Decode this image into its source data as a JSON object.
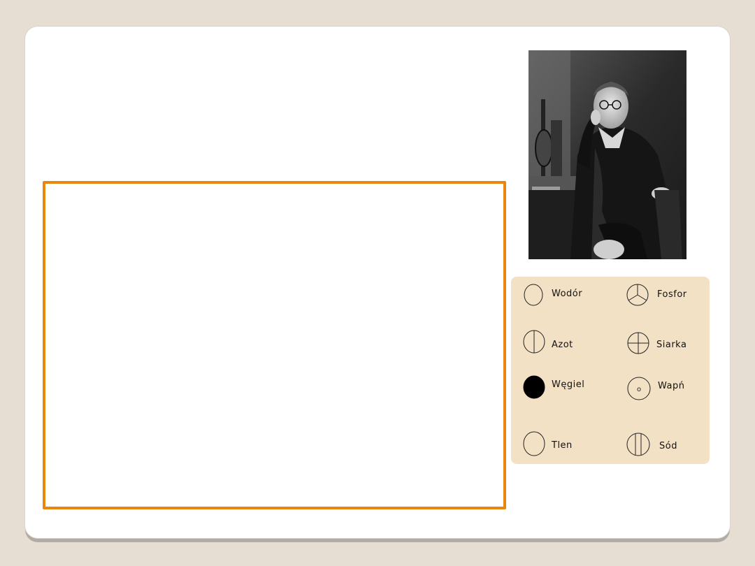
{
  "legend": {
    "elements": [
      {
        "symbol": "plain-circle",
        "label": "Wodór"
      },
      {
        "symbol": "circle-y-lines",
        "label": "Fosfor"
      },
      {
        "symbol": "circle-vertical-line",
        "label": "Azot"
      },
      {
        "symbol": "circle-cross",
        "label": "Siarka"
      },
      {
        "symbol": "filled-circle",
        "label": "Węgiel"
      },
      {
        "symbol": "circle-small-ring",
        "label": "Wapń",
        "inner_mark": "o"
      },
      {
        "symbol": "plain-circle",
        "label": "Tlen"
      },
      {
        "symbol": "circle-two-vertical-lines",
        "label": "Sód"
      }
    ]
  },
  "colors": {
    "background": "#e6ddd3",
    "slide": "#ffffff",
    "accent_border": "#e8860e",
    "legend_panel": "#f3e1c5"
  }
}
